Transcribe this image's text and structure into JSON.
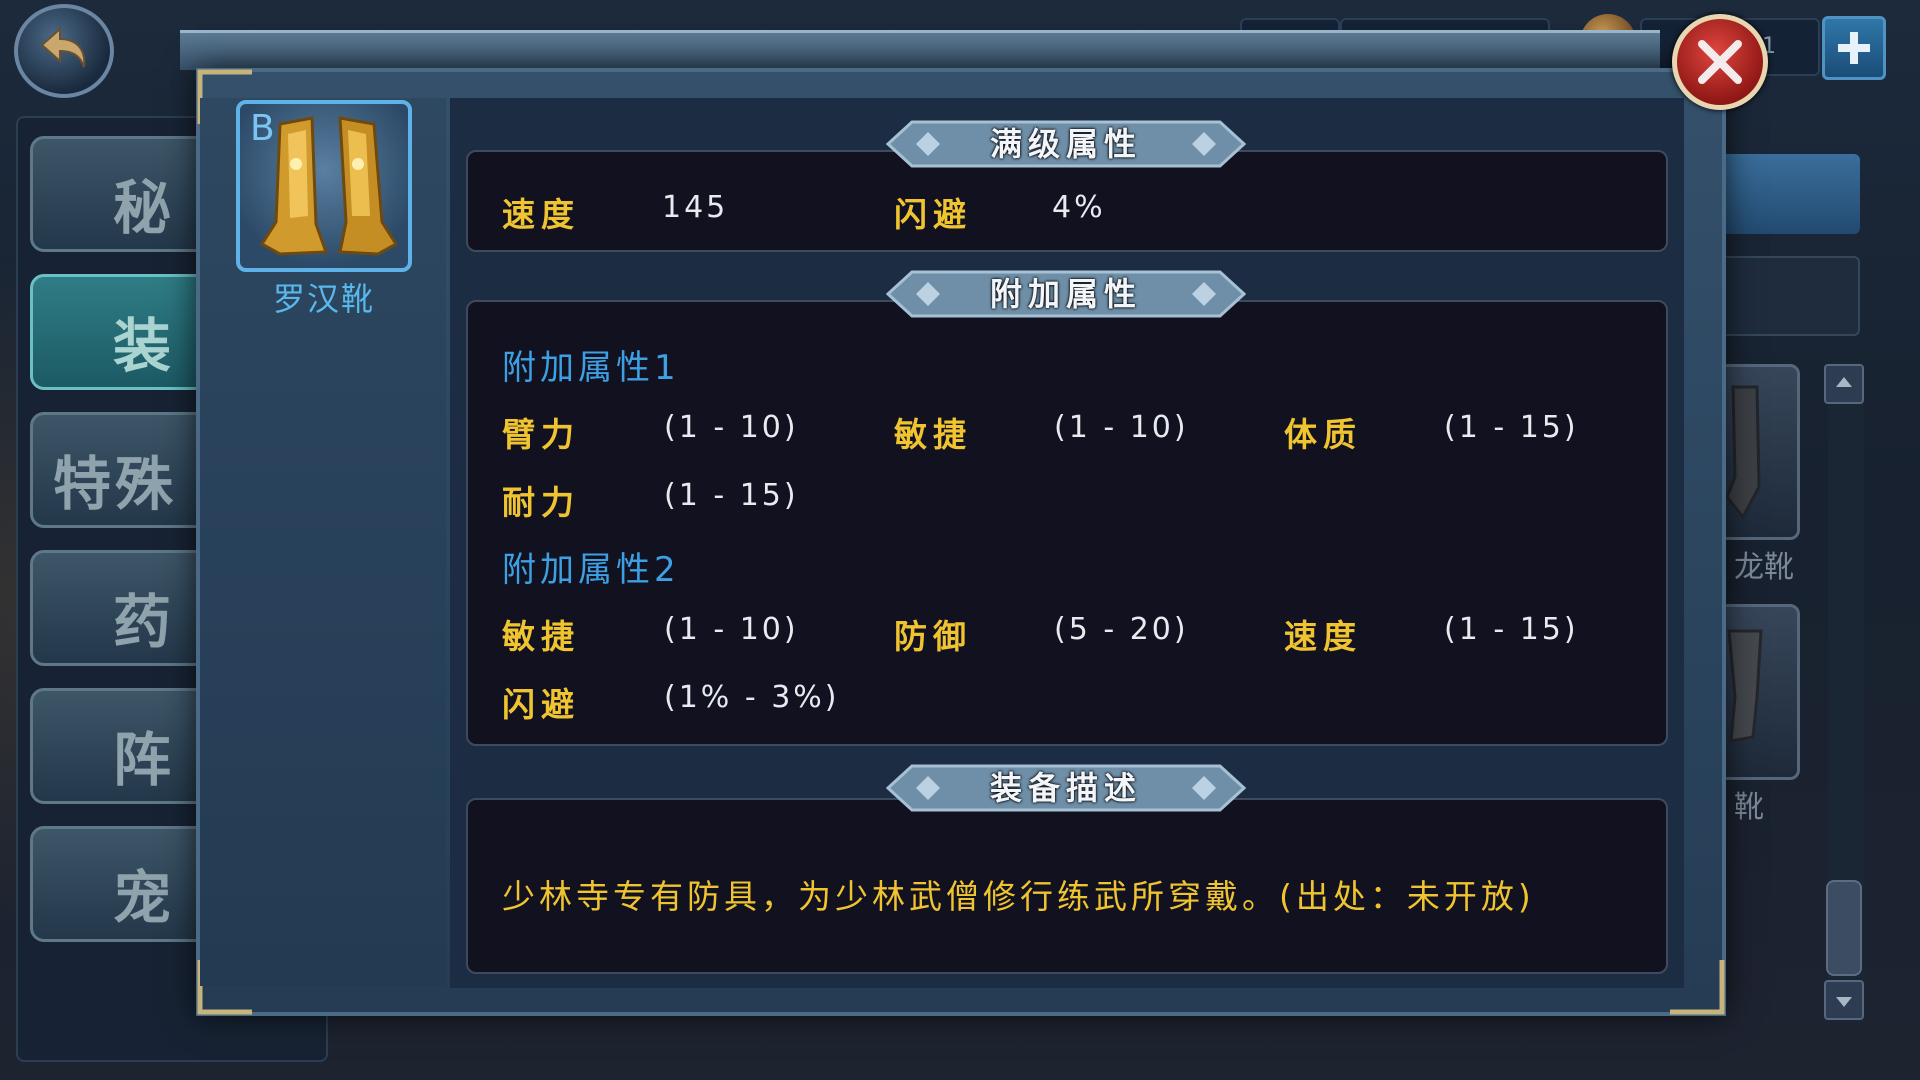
{
  "item": {
    "grade": "B",
    "name": "罗汉靴"
  },
  "sections": {
    "max_level": "满级属性",
    "extra": "附加属性",
    "description": "装备描述"
  },
  "max_stats": [
    {
      "label": "速度",
      "value": "145"
    },
    {
      "label": "闪避",
      "value": "4%"
    }
  ],
  "extra_groups": [
    {
      "title": "附加属性1",
      "stats": [
        {
          "label": "臂力",
          "value": "(1 - 10)"
        },
        {
          "label": "敏捷",
          "value": "(1 - 10)"
        },
        {
          "label": "体质",
          "value": "(1 - 15)"
        },
        {
          "label": "耐力",
          "value": "(1 - 15)"
        }
      ]
    },
    {
      "title": "附加属性2",
      "stats": [
        {
          "label": "敏捷",
          "value": "(1 - 10)"
        },
        {
          "label": "防御",
          "value": "(5 - 20)"
        },
        {
          "label": "速度",
          "value": "(1 - 15)"
        },
        {
          "label": "闪避",
          "value": "(1% - 3%)"
        }
      ]
    }
  ],
  "description_text": "少林寺专有防具，为少林武僧修行练武所穿戴。(出处：未开放)",
  "left_tabs": [
    "秘",
    "装",
    "特殊",
    "药",
    "阵",
    "宠"
  ],
  "right_list": {
    "top_count": "1",
    "items": [
      {
        "label": "龙靴"
      },
      {
        "label": "靴"
      }
    ]
  },
  "colors": {
    "stat_label": "#f0c430",
    "group_title": "#3ea0e4",
    "value": "#e6ebf0",
    "item_name": "#58b8ec",
    "close_red": "#c8302c"
  },
  "icons": {
    "back": "back-arrow-icon",
    "close": "close-x-icon",
    "add": "plus-icon",
    "boots": "boots-icon"
  }
}
